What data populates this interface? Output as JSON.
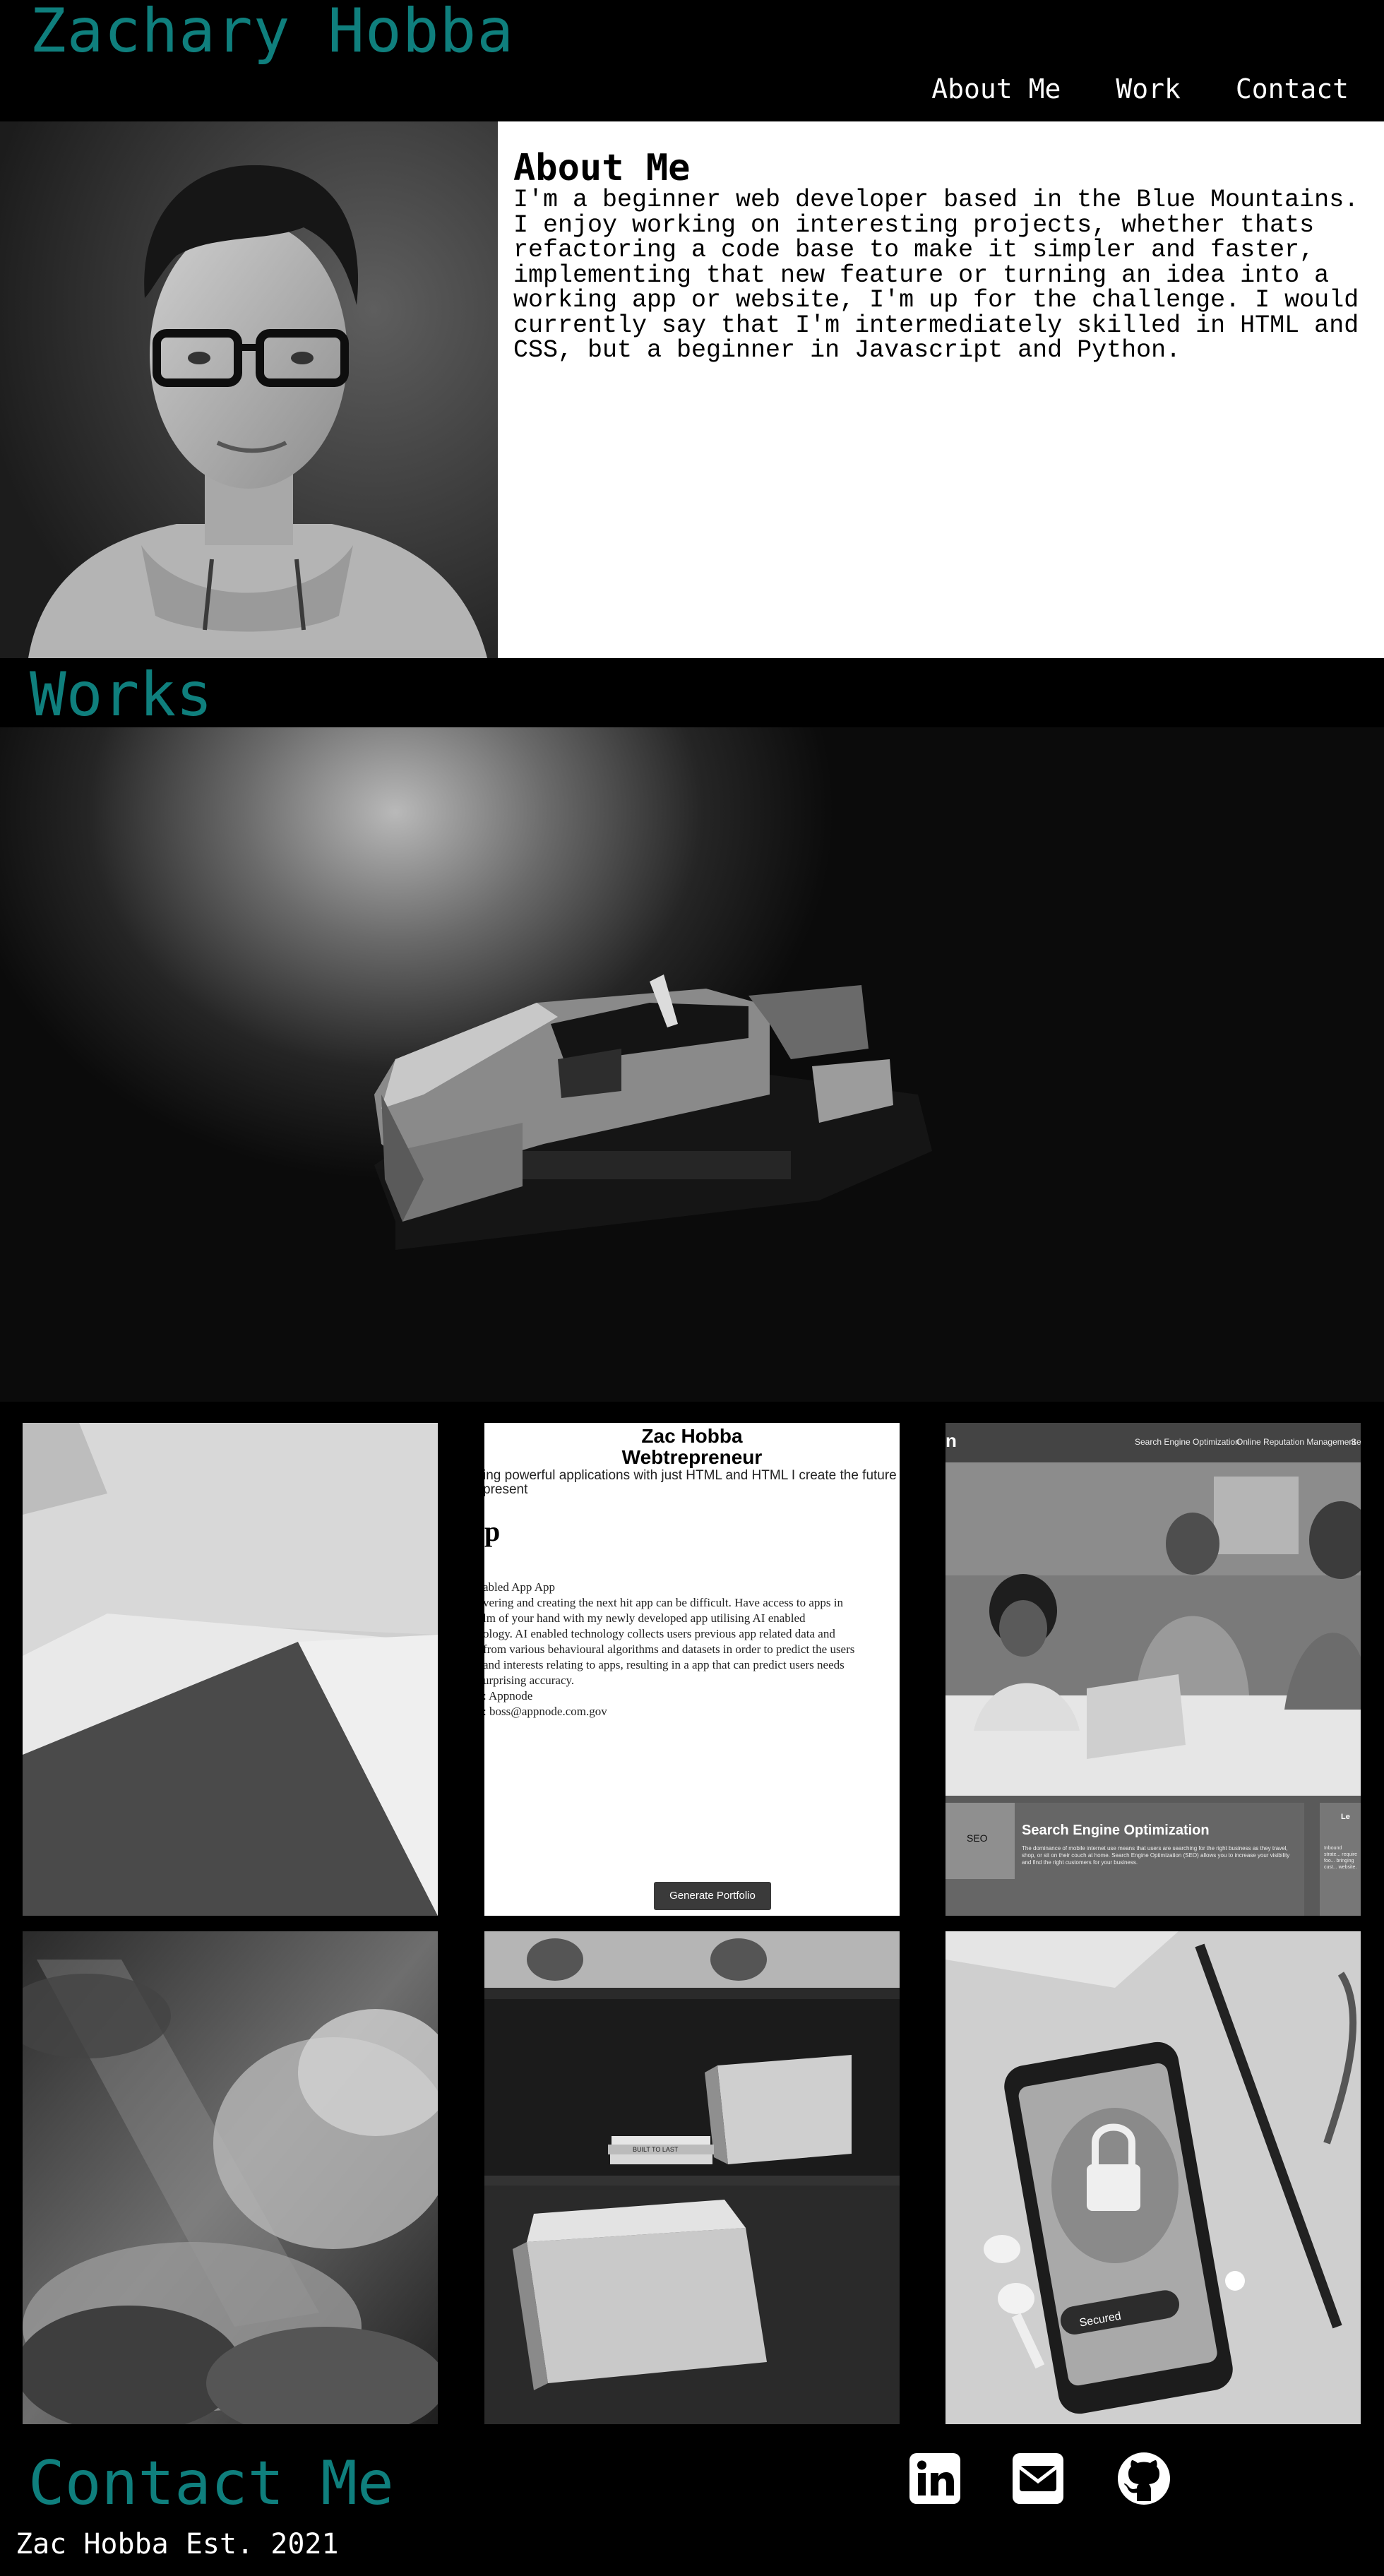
{
  "header": {
    "title": "Zachary Hobba",
    "nav": [
      {
        "label": "About Me"
      },
      {
        "label": "Work"
      },
      {
        "label": "Contact"
      }
    ]
  },
  "about": {
    "heading": "About Me",
    "body": "I'm a beginner web developer based in the Blue Mountains. I enjoy working on interesting projects, whether thats refactoring a code base to make it simpler and faster, implementing that new feature or turning an idea into a working app or website, I'm up for the challenge. I would currently say that I'm intermediately skilled in HTML and CSS, but a beginner in Javascript and Python."
  },
  "works": {
    "title": "Works",
    "preview": {
      "name": "Zac Hobba",
      "subtitle": "Webtrepreneur",
      "tagline": "ing powerful applications with just HTML and HTML I create the future",
      "tagline2": "present",
      "heading": "p",
      "line1": "abled App App",
      "line2": "vering and creating the next hit app can be difficult. Have access to apps in",
      "line3": "lm of your hand with my newly developed app utilising AI enabled",
      "line4": "ology. AI enabled technology collects users previous app related data and",
      "line5": "from various behavioural algorithms and datasets in order to predict the users",
      "line6": "and interests relating to apps, resulting in a app that can predict users needs",
      "line7": "urprising accuracy.",
      "line8": ": Appnode",
      "line9": ": boss@appnode.com.gov",
      "button": "Generate Portfolio"
    },
    "seo": {
      "nav1": "Search Engine Optimization",
      "nav2": "Online Reputation Management",
      "nav3": "Se",
      "heading": "Search Engine Optimization",
      "logo": "n",
      "side_label": "Le",
      "body": "The dominance of mobile internet use means that users are searching for the right business as they travel, shop, or sit on their couch at home. Search Engine Optimization (SEO) allows you to increase your visibility and find the right customers for your business.",
      "badge": "SEO",
      "side_body": "Inbound strate... require foo... bringing cust... website."
    },
    "phone": {
      "status": "Secured"
    },
    "books": {
      "spine": "BUILT TO LAST"
    }
  },
  "contact": {
    "title": "Contact Me",
    "icons": [
      "linkedin-icon",
      "mail-icon",
      "github-icon"
    ]
  },
  "footer": {
    "text": "Zac Hobba Est. 2021"
  },
  "colors": {
    "accent": "#0f7f7d",
    "background": "#000000",
    "panel": "#ffffff"
  }
}
